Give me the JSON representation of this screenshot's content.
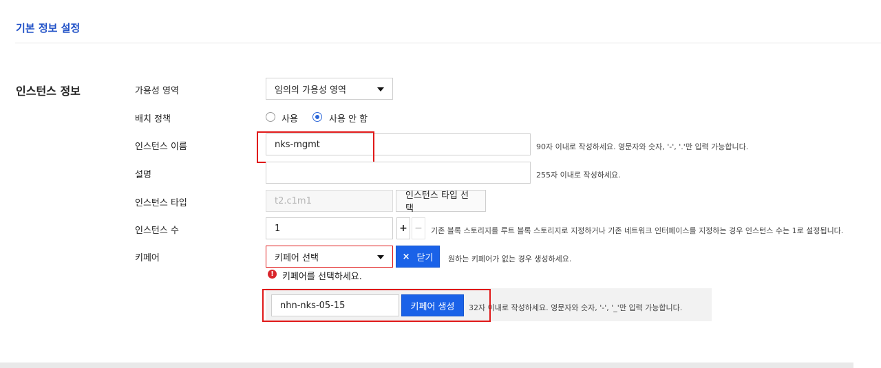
{
  "page": {
    "title": "기본 정보 설정"
  },
  "section": {
    "title": "인스턴스 정보"
  },
  "availability_zone": {
    "label": "가용성 영역",
    "value": "임의의 가용성 영역"
  },
  "placement_policy": {
    "label": "배치 정책",
    "options": [
      {
        "label": "사용",
        "checked": false
      },
      {
        "label": "사용 안 함",
        "checked": true
      }
    ]
  },
  "instance_name": {
    "label": "인스턴스 이름",
    "value": "nks-mgmt",
    "help": "90자 이내로 작성하세요. 영문자와 숫자, '-', '.'만 입력 가능합니다."
  },
  "description": {
    "label": "설명",
    "value": "",
    "help": "255자 이내로 작성하세요."
  },
  "instance_type": {
    "label": "인스턴스 타입",
    "value": "t2.c1m1",
    "select_button": "인스턴스 타입 선택"
  },
  "instance_count": {
    "label": "인스턴스 수",
    "value": "1",
    "plus": "+",
    "minus": "−",
    "help": "기존 블록 스토리지를 루트 블록 스토리지로 지정하거나 기존 네트워크 인터페이스를 지정하는 경우 인스턴스 수는 1로 설정됩니다."
  },
  "keypair": {
    "label": "키페어",
    "select_value": "키페어 선택",
    "close_icon": "×",
    "close_button": "닫기",
    "help": "원하는 키페어가 없는 경우 생성하세요.",
    "error_icon": "!",
    "error": "키페어를 선택하세요.",
    "new_name": "nhn-nks-05-15",
    "create_button": "키페어 생성",
    "create_help": "32자 이내로 작성하세요. 영문자와 숫자, '-', '_'만 입력 가능합니다."
  },
  "colors": {
    "accent": "#1a62e8",
    "title": "#2051c7",
    "highlight": "#e01818",
    "error": "#d9262c"
  }
}
